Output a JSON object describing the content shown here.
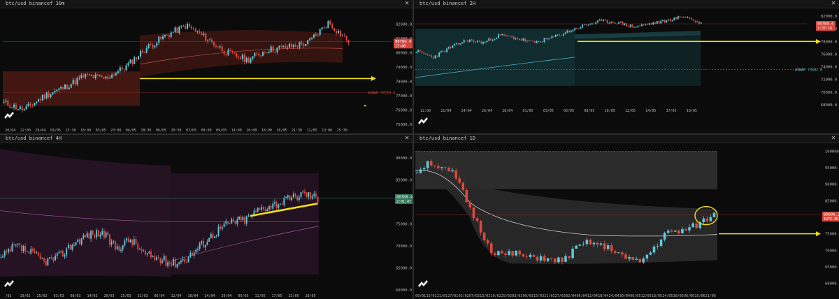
{
  "colors": {
    "bg": "#0b0b0b",
    "up_candle": "#5ec8d8",
    "down_candle": "#e0483c",
    "arrow": "#f2de12",
    "price_label": "#d9463c",
    "band_red": "#5a1d16",
    "band_teal": "#123438",
    "band_purple": "#2a1428",
    "band_gray": "#2a2a2a"
  },
  "logo_icon": "tradingview-logo-icon",
  "close_label": "✕",
  "panels": [
    {
      "title": "btc/usd binancef 30m",
      "price_label": "80788.4",
      "price_sub": "17:40",
      "vwap_label": "AVWAP 77220.0",
      "chart_data": {
        "type": "candlestick",
        "ylim": [
          75000,
          83000
        ],
        "y_ticks": [
          "82000.0",
          "81000.0",
          "80000.0",
          "79000.0",
          "78000.0",
          "77000.0",
          "76000.0",
          "75000.0"
        ],
        "x_ticks": [
          "20/04",
          "22:00",
          "28/04",
          "01/05",
          "15:30",
          "18:00",
          "03/05",
          "23:00",
          "04/05",
          "18:30",
          "06/05",
          "20:30",
          "07/05",
          "08:00",
          "09/05",
          "14:00",
          "10:00",
          "18:00",
          "10/05",
          "21:30",
          "11/05",
          "13:00",
          "15:30"
        ],
        "current_price": 80788.4,
        "arrow_level": 78200,
        "avwap_level": 77220
      }
    },
    {
      "title": "btc/usd binancef 2H",
      "price_label": "80788.4",
      "price_sub": "1:37:16",
      "vwap_label": "AVWAP 73582.0",
      "chart_data": {
        "type": "candlestick",
        "ylim": [
          68000,
          83000
        ],
        "y_ticks": [
          "82000.0",
          "80000.0",
          "78000.0",
          "76000.0",
          "74000.0",
          "72000.0",
          "70000.0",
          "68000.0"
        ],
        "x_ticks": [
          "12:00",
          "21/04",
          "24/04",
          "26/04",
          "28/04",
          "01/05",
          "03/05",
          "05/05",
          "08/05",
          "10/05",
          "12/05",
          "14/05",
          "17/05",
          "19/05"
        ],
        "current_price": 80788.4,
        "arrow_level": 78000,
        "avwap_level": 73582
      }
    },
    {
      "title": "btc/usd binancef 4H",
      "price_label": "80788.4",
      "price_sub": "2:01:47",
      "chart_data": {
        "type": "candlestick",
        "ylim": [
          60000,
          93000
        ],
        "y_ticks": [
          "90000.0",
          "85000.0",
          "80000.0",
          "75000.0",
          "70000.0",
          "65000.0",
          "60000.0"
        ],
        "x_ticks": [
          "/02",
          "19/02",
          "25/02",
          "03/03",
          "08/03",
          "14/03",
          "20/03",
          "25/03",
          "31/03",
          "06/04",
          "12/04",
          "18/04",
          "24/04",
          "29/04",
          "05/05",
          "11/05",
          "17/05",
          "23/05",
          "28/05"
        ],
        "current_price": 80788.4
      }
    },
    {
      "title": "btc/usd binancef 1D",
      "price_label": "80806.3",
      "price_sub": "1D75.4D",
      "chart_data": {
        "type": "candlestick",
        "ylim": [
          58000,
          102000
        ],
        "y_ticks": [
          "100000.0",
          "95000.0",
          "90000.0",
          "85000.0",
          "80000.0",
          "75000.0",
          "70000.0",
          "65000.0",
          "60000.0"
        ],
        "x_ticks": [
          "09/01",
          "15/01",
          "21/01",
          "27/01",
          "02/02",
          "07/02",
          "13/02",
          "19/02",
          "25/02",
          "03/03",
          "09/03",
          "15/03",
          "21/03",
          "27/03",
          "02/04",
          "06/04",
          "12/04",
          "18/04",
          "24/04",
          "30/04",
          "06/05",
          "12/05",
          "18/05",
          "24/05",
          "30/05",
          "06/06",
          "15/06",
          "21/06"
        ],
        "current_price": 80806.3,
        "arrow_level": 75000
      }
    }
  ]
}
